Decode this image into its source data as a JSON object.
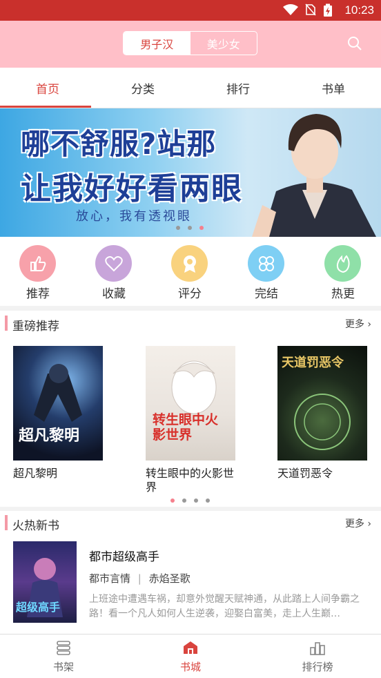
{
  "status_bar": {
    "time": "10:23"
  },
  "header": {
    "segment": [
      "男子汉",
      "美少女"
    ],
    "active_segment": 0
  },
  "tabs": [
    "首页",
    "分类",
    "排行",
    "书单"
  ],
  "banner": {
    "line1": "哪不舒服?站那",
    "line2": "让我好好看两眼",
    "line3": "放心，我有透视眼"
  },
  "quick_actions": [
    {
      "label": "推荐",
      "icon": "thumbs-up-icon",
      "color": "#f7a1aa"
    },
    {
      "label": "收藏",
      "icon": "heart-icon",
      "color": "#c8a5da"
    },
    {
      "label": "评分",
      "icon": "medal-icon",
      "color": "#f9d27e"
    },
    {
      "label": "完结",
      "icon": "clover-icon",
      "color": "#7ecff4"
    },
    {
      "label": "热更",
      "icon": "flame-icon",
      "color": "#8fe0a8"
    }
  ],
  "featured": {
    "title": "重磅推荐",
    "more": "更多",
    "books": [
      {
        "title": "超凡黎明",
        "cover_text": "超凡黎明"
      },
      {
        "title": "转生眼中的火影世界",
        "cover_text": "转生眼中火影世界"
      },
      {
        "title": "天道罚恶令",
        "cover_text": "天道罚恶令"
      }
    ]
  },
  "hot_new": {
    "title": "火热新书",
    "more": "更多",
    "book": {
      "title": "都市超级高手",
      "genre": "都市言情",
      "author": "赤焰圣歌",
      "description": "上班途中遭遇车祸，却意外觉醒天赋神通，从此踏上人间争霸之路！看一个凡人如何人生逆袭，迎娶白富美，走上人生巅…",
      "cover_text": "超级高手"
    }
  },
  "bottom_nav": [
    "书架",
    "书城",
    "排行榜"
  ],
  "bottom_nav_active": 1,
  "colors": {
    "accent": "#d9443e",
    "header_bg": "#ffbfc8",
    "status_bar": "#c9302c"
  }
}
